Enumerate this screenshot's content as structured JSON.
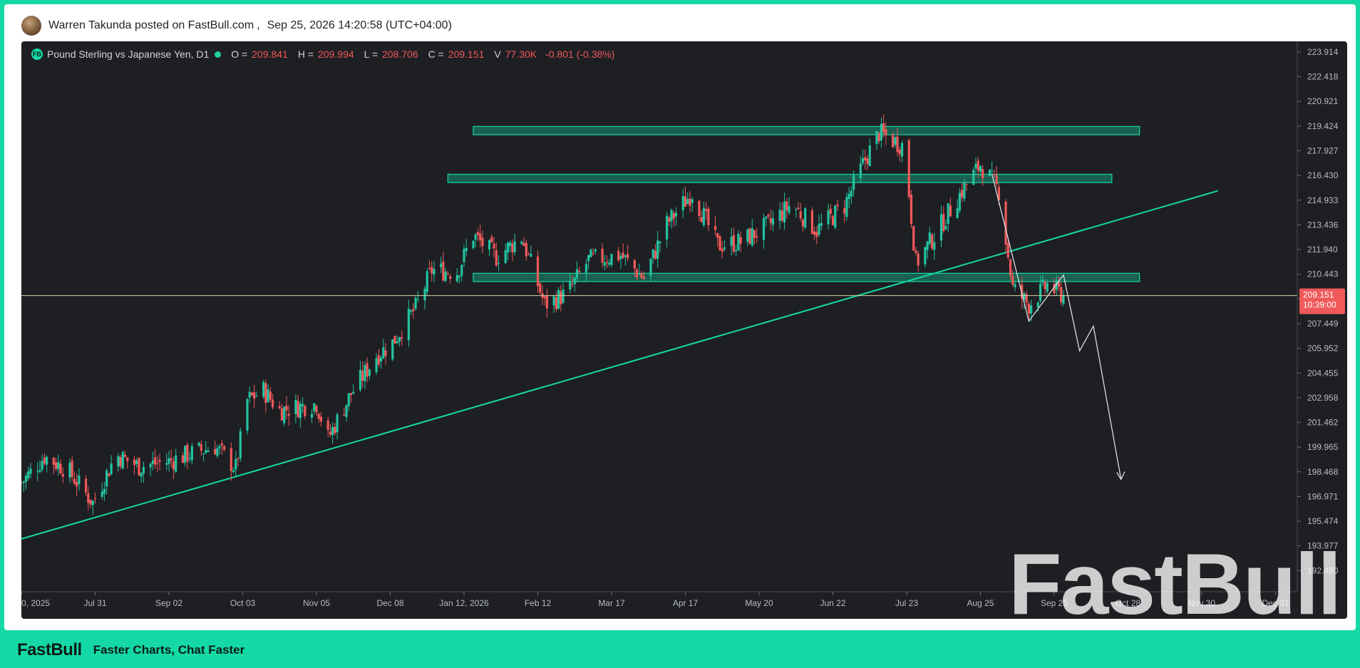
{
  "post": {
    "author_line": "Warren Takunda posted on FastBull.com",
    "separator": ",",
    "timestamp": "Sep 25, 2026 14:20:58 (UTC+04:00)"
  },
  "legend": {
    "badge": "FB",
    "symbol": "Pound Sterling vs Japanese Yen, D1",
    "o_label": "O =",
    "o": "209.841",
    "h_label": "H =",
    "h": "209.994",
    "l_label": "L =",
    "l": "208.706",
    "c_label": "C =",
    "c": "209.151",
    "v_label": "V",
    "v": "77.30K",
    "change": "-0.801 (-0.38%)"
  },
  "price_tag": {
    "price": "209.151",
    "countdown": "10:39:00"
  },
  "watermark": "FastBull",
  "footer": {
    "logo": "FastBull",
    "tagline": "Faster Charts, Chat Faster"
  },
  "colors": {
    "background": "#1e1f23",
    "up": "#22c3a0",
    "down": "#f0595a",
    "zone": "#14d9a6",
    "trendline": "#14d9a6",
    "current_price_line": "#d9d3a6",
    "brand": "#14d9a6"
  },
  "chart_data": {
    "type": "candlestick",
    "title": "Pound Sterling vs Japanese Yen, D1",
    "y_ticks": [
      "223.914",
      "222.418",
      "220.921",
      "219.424",
      "217.927",
      "216.430",
      "214.933",
      "213.436",
      "211.940",
      "210.443",
      "208.946",
      "207.449",
      "205.952",
      "204.455",
      "202.958",
      "201.462",
      "199.965",
      "198.468",
      "196.971",
      "195.474",
      "193.977",
      "192.480"
    ],
    "y_range": [
      191.2,
      224.3
    ],
    "x_ticks": [
      "0, 2025",
      "Jul 31",
      "Sep 02",
      "Oct 03",
      "Nov 05",
      "Dec 08",
      "Jan 12, 2026",
      "Feb 12",
      "Mar 17",
      "Apr 17",
      "May 20",
      "Jun 22",
      "Jul 23",
      "Aug 25",
      "Sep 25",
      "Oct 28",
      "Nov 30",
      "Dec 31"
    ],
    "price_path": [
      [
        "Jun 30, 2025",
        197.8
      ],
      [
        "Jul 10, 2025",
        199.4
      ],
      [
        "Jul 20, 2025",
        198.6
      ],
      [
        "Jul 31, 2025",
        196.6
      ],
      [
        "Aug 10, 2025",
        199.5
      ],
      [
        "Aug 20, 2025",
        198.8
      ],
      [
        "Sep 02, 2025",
        199.1
      ],
      [
        "Sep 12, 2025",
        199.6
      ],
      [
        "Sep 22, 2025",
        200.0
      ],
      [
        "Oct 01, 2025",
        198.7
      ],
      [
        "Oct 06, 2025",
        202.8
      ],
      [
        "Oct 13, 2025",
        203.4
      ],
      [
        "Oct 20, 2025",
        202.2
      ],
      [
        "Nov 05, 2025",
        202.6
      ],
      [
        "Nov 10, 2025",
        200.5
      ],
      [
        "Nov 20, 2025",
        203.2
      ],
      [
        "Dec 01, 2025",
        205.5
      ],
      [
        "Dec 08, 2025",
        206.3
      ],
      [
        "Dec 18, 2025",
        208.4
      ],
      [
        "Dec 25, 2025",
        210.7
      ],
      [
        "Jan 05, 2026",
        210.6
      ],
      [
        "Jan 12, 2026",
        212.8
      ],
      [
        "Jan 22, 2026",
        211.5
      ],
      [
        "Feb 02, 2026",
        212.7
      ],
      [
        "Feb 12, 2026",
        208.6
      ],
      [
        "Feb 22, 2026",
        209.3
      ],
      [
        "Mar 03, 2026",
        211.3
      ],
      [
        "Mar 17, 2026",
        211.6
      ],
      [
        "Mar 27, 2026",
        210.2
      ],
      [
        "Apr 06, 2026",
        213.5
      ],
      [
        "Apr 17, 2026",
        215.4
      ],
      [
        "Apr 28, 2026",
        212.2
      ],
      [
        "May 08, 2026",
        212.4
      ],
      [
        "May 20, 2026",
        213.4
      ],
      [
        "May 30, 2026",
        214.7
      ],
      [
        "Jun 10, 2026",
        213.1
      ],
      [
        "Jun 22, 2026",
        214.6
      ],
      [
        "Jul 01, 2026",
        217.4
      ],
      [
        "Jul 07, 2026",
        219.0
      ],
      [
        "Jul 18, 2026",
        218.2
      ],
      [
        "Jul 23, 2026",
        211.1
      ],
      [
        "Aug 01, 2026",
        213.0
      ],
      [
        "Aug 12, 2026",
        215.5
      ],
      [
        "Aug 20, 2026",
        217.1
      ],
      [
        "Aug 28, 2026",
        215.5
      ],
      [
        "Sep 03, 2026",
        209.6
      ],
      [
        "Sep 10, 2026",
        208.6
      ],
      [
        "Sep 18, 2026",
        209.8
      ],
      [
        "Sep 25, 2026",
        209.15
      ]
    ],
    "last_ohlc": {
      "open": 209.841,
      "high": 209.994,
      "low": 208.706,
      "close": 209.151,
      "volume": "77.30K"
    },
    "zones": [
      {
        "start": "Jan 12, 2026",
        "end": "Oct 28, 2026",
        "low": 218.9,
        "high": 219.4
      },
      {
        "start": "Jan 01, 2026",
        "end": "Oct 16, 2026",
        "low": 216.0,
        "high": 216.5
      },
      {
        "start": "Jan 12, 2026",
        "end": "Oct 28, 2026",
        "low": 210.0,
        "high": 210.5
      }
    ],
    "trendline": [
      [
        "Jun 30, 2025",
        194.4
      ],
      [
        "Dec 01, 2026",
        215.5
      ]
    ],
    "projection": [
      [
        "Aug 25, 2026",
        216.5
      ],
      [
        "Sep 10, 2026",
        207.6
      ],
      [
        "Sep 25, 2026",
        210.4
      ],
      [
        "Oct 02, 2026",
        205.8
      ],
      [
        "Oct 08, 2026",
        207.3
      ],
      [
        "Oct 20, 2026",
        198.0
      ]
    ],
    "current_price": 209.151,
    "grid": false
  }
}
